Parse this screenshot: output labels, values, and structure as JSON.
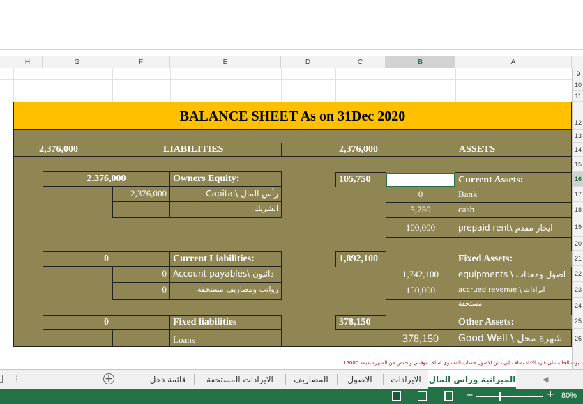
{
  "columns": [
    "H",
    "G",
    "F",
    "E",
    "D",
    "C",
    "B",
    "A"
  ],
  "rows": [
    "9",
    "10",
    "11",
    "12",
    "13",
    "14",
    "15",
    "16",
    "17",
    "18",
    "19",
    "20",
    "21",
    "22",
    "23",
    "24",
    "25",
    "26"
  ],
  "title": "BALANCE SHEET As on 31Dec 2020",
  "liabilities_total": "2,376,000",
  "liabilities_label": "LIABILITIES",
  "assets_total": "2,376,000",
  "assets_label": "ASSETS",
  "owners_equity": {
    "total": "2,376,000",
    "label": "Owners Equity:",
    "items": [
      {
        "value": "2,376,000",
        "label": "Capital\\ رأس المال"
      },
      {
        "value": "",
        "label": "الشريك"
      }
    ]
  },
  "current_liabilities": {
    "total": "0",
    "label": "Current Liabilities:",
    "items": [
      {
        "value": "0",
        "label": "Account payables\\ دائنون"
      },
      {
        "value": "0",
        "label": "رواتب ومصاريف مستحقة"
      }
    ]
  },
  "fixed_liabilities": {
    "total": "0",
    "label": "Fixed liabilities",
    "items": [
      {
        "value": "",
        "label": "Loans"
      }
    ]
  },
  "current_assets": {
    "total": "105,750",
    "label": "Current Assets:",
    "items": [
      {
        "value": "0",
        "label": "Bank"
      },
      {
        "value": "5,750",
        "label": "cash"
      },
      {
        "value": "100,000",
        "label": "prepaid rent\\ ايجار مقدم"
      }
    ]
  },
  "fixed_assets": {
    "total": "1,892,100",
    "label": "Fixed Assets:",
    "items": [
      {
        "value": "1,742,100",
        "label": "equipments \\ اصول ومعدات"
      },
      {
        "value": "150,000",
        "label": "accrued revenue \\ ايرادات مستحقة"
      }
    ]
  },
  "other_assets": {
    "total": "378,150",
    "label": "Other Assets:",
    "items": [
      {
        "value": "378,150",
        "label": "Good Well \\ شهرة محل"
      }
    ]
  },
  "note": "في حالة ثبوت الحالة على قارة الاداء تضاف الى دائن الاصول حساب المستوى اساف مؤقتتي وتخفض من الشهرة بقيمة 15000",
  "tabs": [
    "الميزانية وراس المال",
    "الايرادات",
    "الاصول",
    "المصاريف",
    "الايرادات المستحقة",
    "قائمة دخل"
  ],
  "zoom": "80%",
  "colors": {
    "gold": "#ffc000",
    "olive": "#8f8654",
    "excel_green": "#217346"
  }
}
